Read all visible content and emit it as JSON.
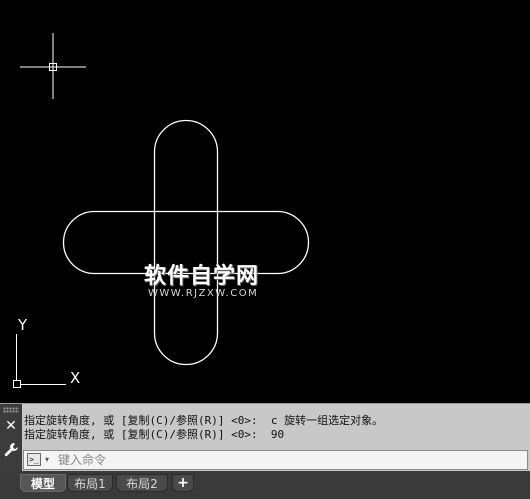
{
  "viewport": {
    "watermark_cn": "软件自学网",
    "watermark_en": "WWW.RJZXW.COM",
    "ucs_x_label": "X",
    "ucs_y_label": "Y",
    "colors": {
      "background": "#000000",
      "geometry": "#ffffff"
    }
  },
  "command": {
    "history": [
      "指定旋转角度, 或 [复制(C)/参照(R)] <0>:  c 旋转一组选定对象。",
      "指定旋转角度, 或 [复制(C)/参照(R)] <0>:  90"
    ],
    "prompt_symbol": ">_",
    "input_placeholder": "键入命令",
    "input_value": ""
  },
  "tabs": {
    "items": [
      {
        "label": "模型",
        "active": true
      },
      {
        "label": "布局1",
        "active": false
      },
      {
        "label": "布局2",
        "active": false
      }
    ],
    "add_label": "+"
  }
}
